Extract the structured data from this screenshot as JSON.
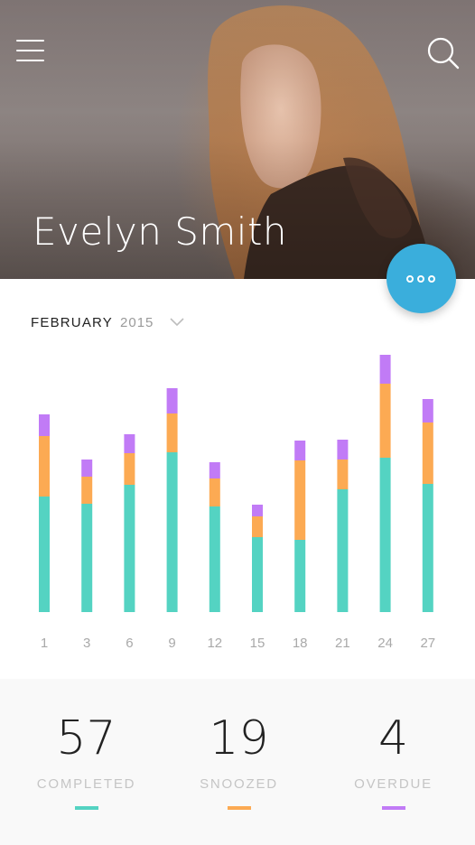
{
  "header": {
    "profile_name": "Evelyn Smith",
    "menu_icon": "hamburger-menu-icon",
    "search_icon": "search-icon",
    "fab_icon": "more-dots-icon"
  },
  "picker": {
    "month": "FEBRUARY",
    "year": "2015",
    "chevron_icon": "chevron-down-icon"
  },
  "colors": {
    "completed": "#54d3c2",
    "snoozed": "#fcaa53",
    "overdue": "#c17bf6",
    "accent": "#3aaedc"
  },
  "chart_data": {
    "type": "bar",
    "stacked": true,
    "categories": [
      "1",
      "3",
      "6",
      "9",
      "12",
      "15",
      "18",
      "21",
      "24",
      "27"
    ],
    "series": [
      {
        "name": "COMPLETED",
        "values": [
          128,
          120,
          141,
          177,
          117,
          83,
          80,
          136,
          171,
          142
        ]
      },
      {
        "name": "SNOOZED",
        "values": [
          67,
          30,
          35,
          43,
          31,
          23,
          88,
          33,
          82,
          68
        ]
      },
      {
        "name": "OVERDUE",
        "values": [
          24,
          19,
          21,
          28,
          18,
          13,
          22,
          22,
          32,
          26
        ]
      }
    ],
    "ylim": [
      0,
      285
    ],
    "grid": false
  },
  "stats": [
    {
      "value": "57",
      "label": "COMPLETED",
      "color": "#54d3c2"
    },
    {
      "value": "19",
      "label": "SNOOZED",
      "color": "#fcaa53"
    },
    {
      "value": "4",
      "label": "OVERDUE",
      "color": "#c17bf6"
    }
  ]
}
